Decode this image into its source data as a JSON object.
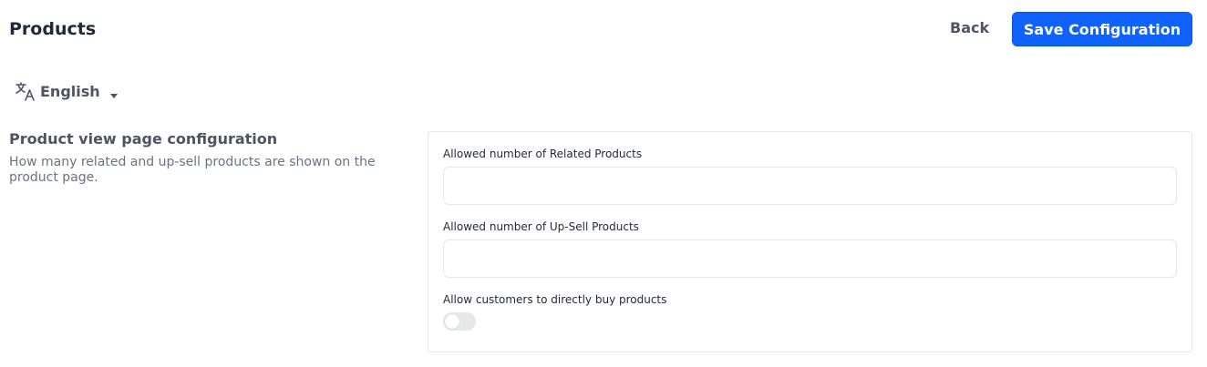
{
  "header": {
    "title": "Products",
    "back_label": "Back",
    "save_label": "Save Configuration"
  },
  "language": {
    "selected": "English",
    "icon": "translate-icon"
  },
  "section": {
    "title": "Product view page configuration",
    "description": "How many related and up-sell products are shown on the product page."
  },
  "fields": {
    "related": {
      "label": "Allowed number of Related Products",
      "value": ""
    },
    "upsell": {
      "label": "Allowed number of Up-Sell Products",
      "value": ""
    },
    "buy_now": {
      "label": "Allow customers to directly buy products",
      "enabled": false
    }
  },
  "colors": {
    "accent": "#0f62fe",
    "toggle_off": "#e5e7eb"
  }
}
